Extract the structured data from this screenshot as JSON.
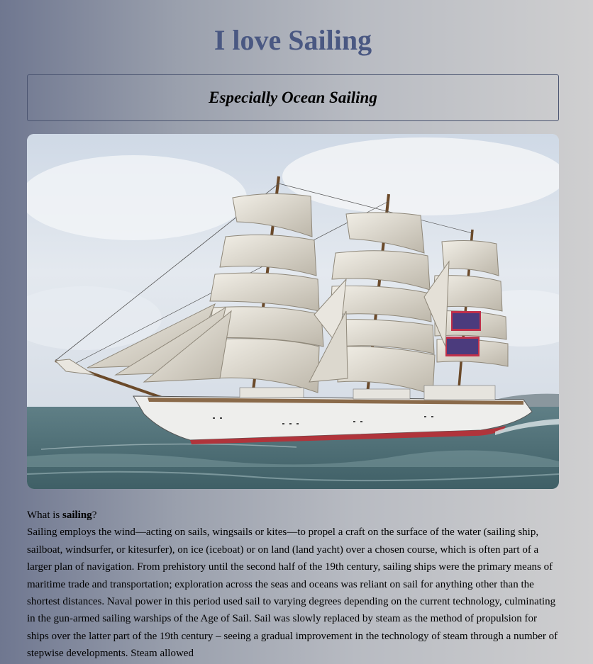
{
  "header": {
    "title": "I love Sailing",
    "subtitle": "Especially Ocean Sailing"
  },
  "hero_image": {
    "alt": "Tall ship under full sail on the ocean"
  },
  "article": {
    "question_prefix": "What is ",
    "question_term": "sailing",
    "question_suffix": "?",
    "body": "Sailing employs the wind—acting on sails, wingsails or kites—to propel a craft on the surface of the water (sailing ship, sailboat, windsurfer, or kitesurfer), on ice (iceboat) or on land (land yacht) over a chosen course, which is often part of a larger plan of navigation. From prehistory until the second half of the 19th century, sailing ships were the primary means of maritime trade and transportation; exploration across the seas and oceans was reliant on sail for anything other than the shortest distances. Naval power in this period used sail to varying degrees depending on the current technology, culminating in the gun-armed sailing warships of the Age of Sail. Sail was slowly replaced by steam as the method of propulsion for ships over the latter part of the 19th century – seeing a gradual improvement in the technology of steam through a number of stepwise developments. Steam allowed"
  },
  "colors": {
    "title": "#4a5882",
    "border": "#4a5470"
  }
}
